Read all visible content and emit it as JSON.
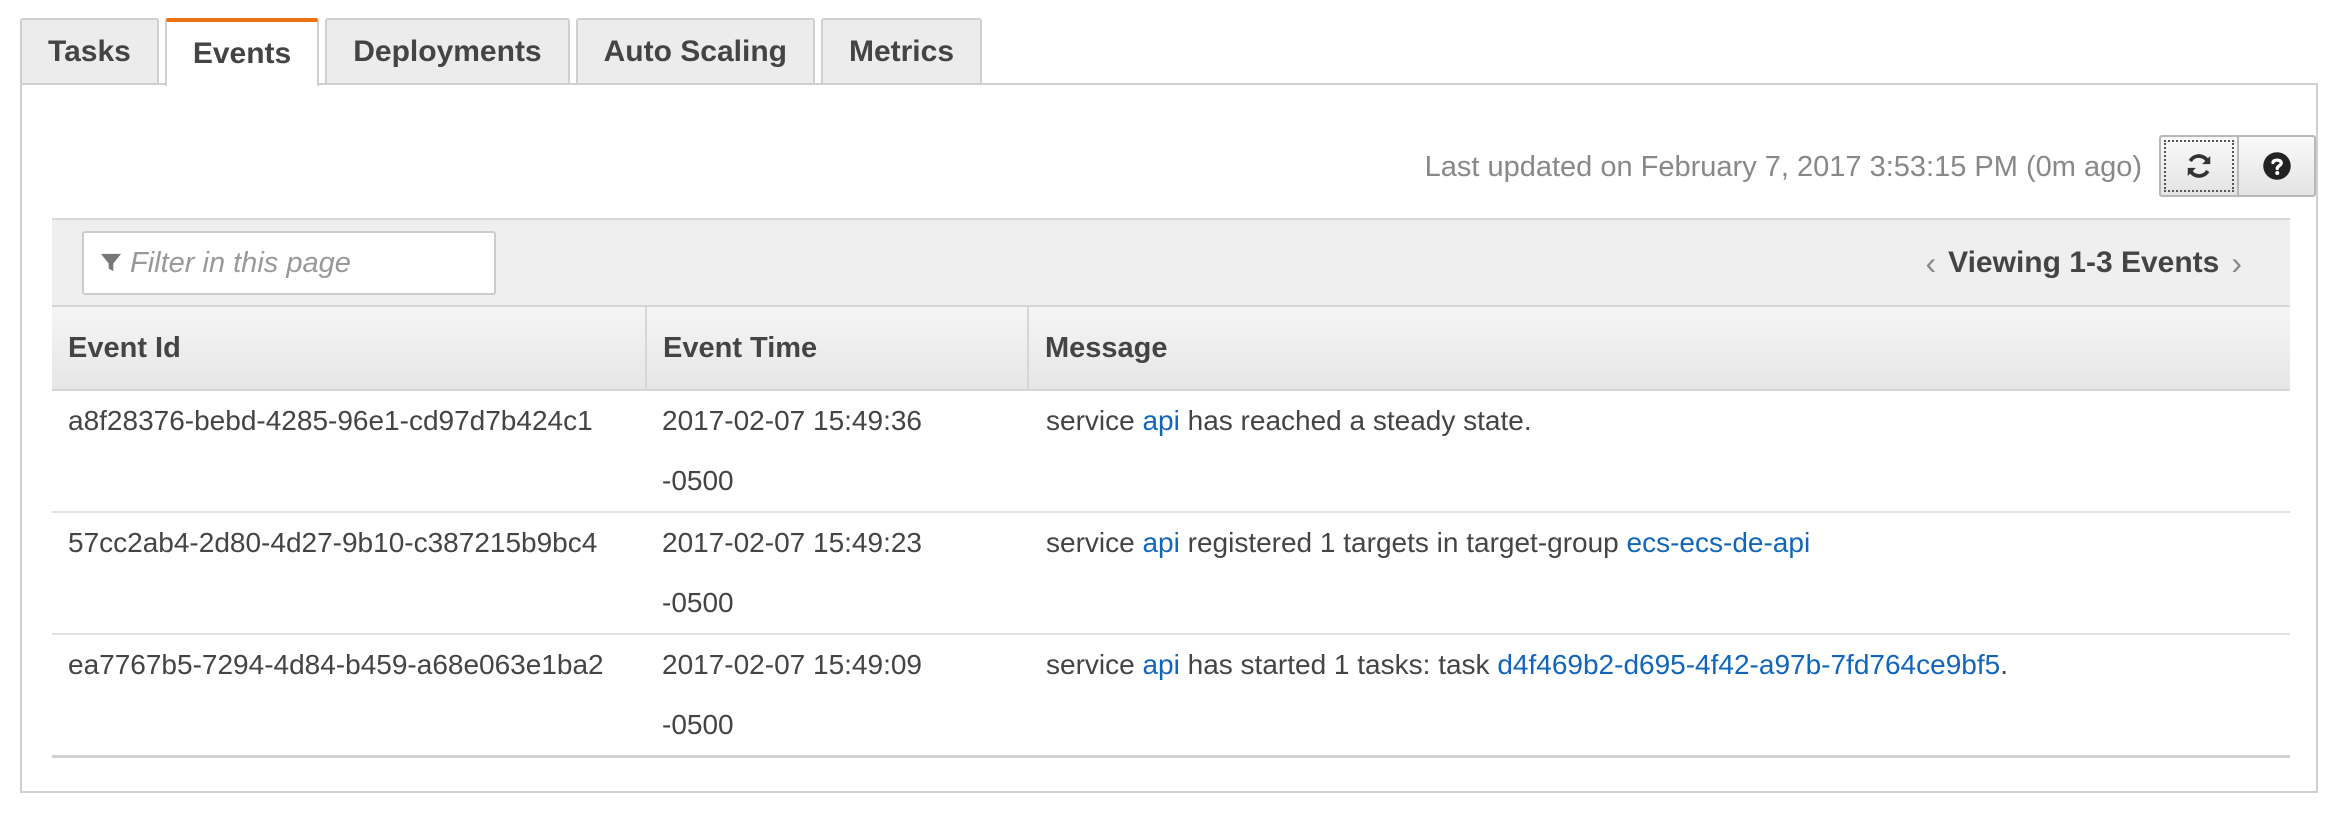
{
  "tabs": [
    {
      "label": "Tasks",
      "active": false
    },
    {
      "label": "Events",
      "active": true
    },
    {
      "label": "Deployments",
      "active": false
    },
    {
      "label": "Auto Scaling",
      "active": false
    },
    {
      "label": "Metrics",
      "active": false
    }
  ],
  "toolbar": {
    "last_updated": "Last updated on February 7, 2017 3:53:15 PM (0m ago)",
    "refresh_icon": "refresh-icon",
    "help_icon": "question-circle-icon"
  },
  "filter": {
    "placeholder": "Filter in this page",
    "icon": "filter-icon"
  },
  "pager": {
    "label": "Viewing 1-3 Events"
  },
  "table": {
    "headers": [
      "Event Id",
      "Event Time",
      "Message"
    ],
    "rows": [
      {
        "event_id": "a8f28376-bebd-4285-96e1-cd97d7b424c1",
        "time_date": "2017-02-07 15:49:36",
        "time_tz": "-0500",
        "msg_pre": "service ",
        "msg_link1": "api",
        "msg_mid": " has reached a steady state.",
        "msg_link2": "",
        "msg_post": ""
      },
      {
        "event_id": "57cc2ab4-2d80-4d27-9b10-c387215b9bc4",
        "time_date": "2017-02-07 15:49:23",
        "time_tz": "-0500",
        "msg_pre": "service ",
        "msg_link1": "api",
        "msg_mid": " registered 1 targets in target-group ",
        "msg_link2": "ecs-ecs-de-api",
        "msg_post": ""
      },
      {
        "event_id": "ea7767b5-7294-4d84-b459-a68e063e1ba2",
        "time_date": "2017-02-07 15:49:09",
        "time_tz": "-0500",
        "msg_pre": "service ",
        "msg_link1": "api",
        "msg_mid": " has started 1 tasks: task ",
        "msg_link2": "d4f469b2-d695-4f42-a97b-7fd764ce9bf5",
        "msg_post": "."
      }
    ]
  },
  "colors": {
    "active_tab_accent": "#ec7211",
    "link": "#1166bb"
  }
}
